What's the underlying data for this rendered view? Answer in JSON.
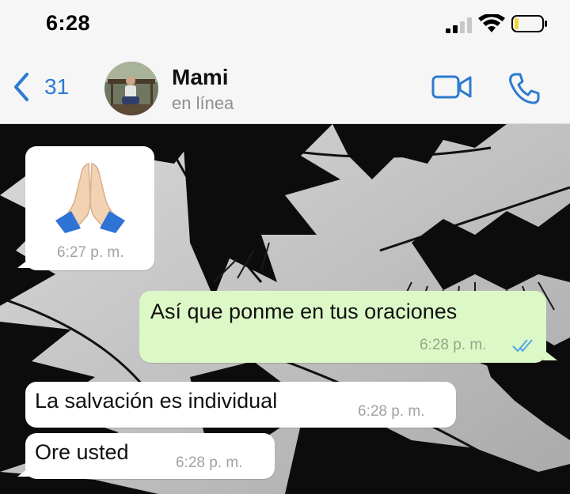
{
  "status_bar": {
    "time": "6:28"
  },
  "header": {
    "back_count": "31",
    "contact_name": "Mami",
    "contact_status": "en línea"
  },
  "messages": [
    {
      "direction": "incoming",
      "emoji": "🙏🏻",
      "time": "6:27 p. m."
    },
    {
      "direction": "outgoing",
      "text": "Así que ponme en tus oraciones",
      "time": "6:28 p. m.",
      "read_receipt": "double-check-icon"
    },
    {
      "direction": "incoming",
      "text": "La salvación es individual",
      "time": "6:28 p. m."
    },
    {
      "direction": "incoming",
      "text": "Ore usted",
      "time": "6:28 p. m."
    }
  ],
  "colors": {
    "accent": "#2b7bd0",
    "outgoing_bubble": "#dcf8c6",
    "incoming_bubble": "#ffffff",
    "read_check": "#53a6e8"
  }
}
